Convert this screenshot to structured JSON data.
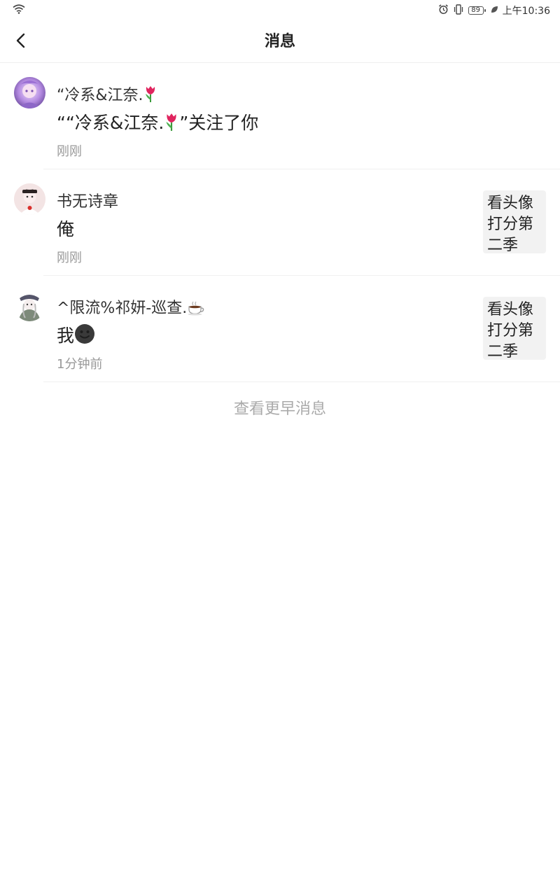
{
  "status_bar": {
    "time": "上午10:36",
    "battery_level": "89",
    "icons": [
      "wifi-icon",
      "alarm-icon",
      "vibrate-icon",
      "battery-icon",
      "leaf-icon"
    ]
  },
  "header": {
    "title": "消息",
    "back_icon": "chevron-left-icon"
  },
  "messages": [
    {
      "name": "“冷系&江奈.",
      "content": "““冷系&江奈.",
      "content_suffix": "”关注了你",
      "time": "刚刚",
      "thumbnail_text": ""
    },
    {
      "name": "书无诗章",
      "content": "俺",
      "content_suffix": "",
      "time": "刚刚",
      "thumbnail_text": "看头像打分第二季"
    },
    {
      "name": "^限流%祁妍-巡查.",
      "content": "我",
      "content_suffix": "",
      "time": "1分钟前",
      "thumbnail_text": "看头像打分第二季"
    }
  ],
  "footer": {
    "more_label": "查看更早消息"
  }
}
